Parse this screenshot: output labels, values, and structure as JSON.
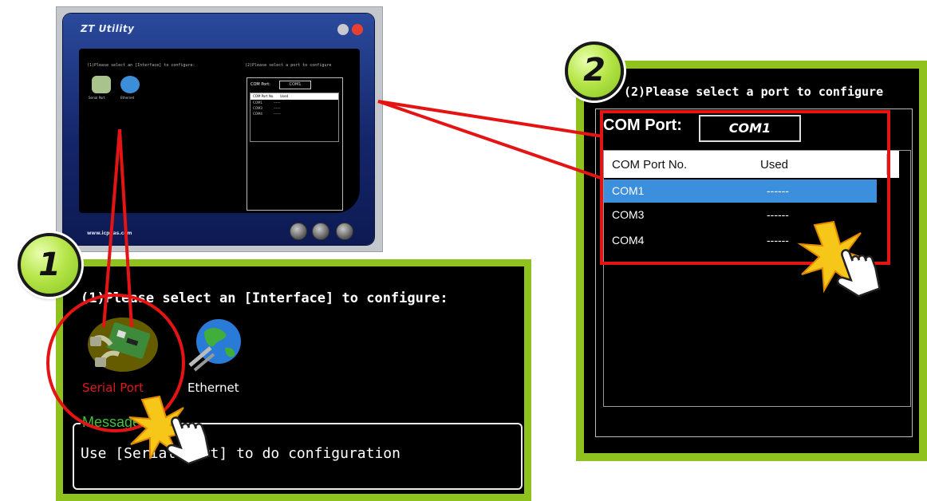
{
  "mini_window": {
    "title": "ZT Utility",
    "step1_text": "(1)Please select an [Interface] to configure:",
    "step2_text": "(2)Please select a port to configure",
    "icons": [
      "Serial Port",
      "Ethernet"
    ],
    "com_port_label": "COM Port:",
    "com_port_value": "COM1",
    "list_header": [
      "COM Port No.",
      "Used"
    ],
    "rows": [
      [
        "COM1",
        "------"
      ],
      [
        "COM3",
        "------"
      ],
      [
        "COM4",
        "------"
      ]
    ],
    "footer_url": "www.icpdas.com"
  },
  "panel1": {
    "badge": "1",
    "heading": "(1)Please select an [Interface] to configure:",
    "serial_label": "Serial Port",
    "ethernet_label": "Ethernet",
    "message_title": "Message",
    "message_text": "Use [Serial Port] to do configuration"
  },
  "panel2": {
    "badge": "2",
    "heading": "(2)Please select a port to configure",
    "com_port_label": "COM Port:",
    "com_port_value": "COM1",
    "columns": [
      "COM Port No.",
      "Used"
    ],
    "rows": [
      {
        "port": "COM1",
        "used": "------",
        "selected": true
      },
      {
        "port": "COM3",
        "used": "------",
        "selected": false
      },
      {
        "port": "COM4",
        "used": "------",
        "selected": false
      }
    ]
  },
  "colors": {
    "frame_green": "#8fc21e",
    "highlight_red": "#e41414",
    "selection_blue": "#3b8fdc",
    "message_green": "#3bc43b"
  }
}
